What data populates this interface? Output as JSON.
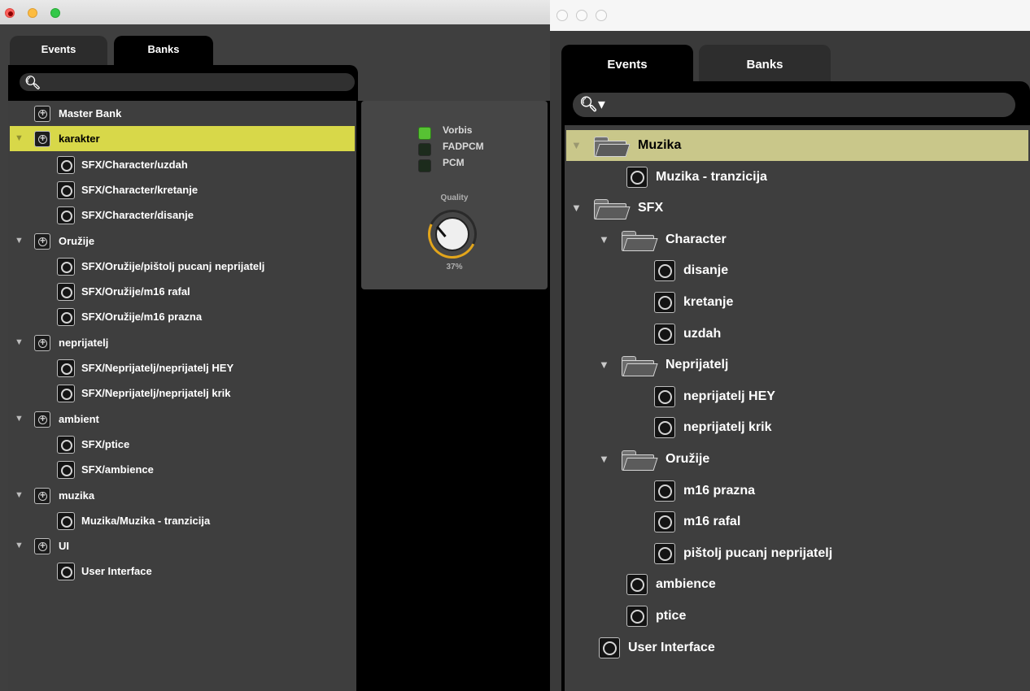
{
  "left_window": {
    "tabs": [
      {
        "label": "Events",
        "active": false
      },
      {
        "label": "Banks",
        "active": true
      }
    ],
    "search": {
      "placeholder": ""
    },
    "tree": [
      {
        "label": "Master Bank",
        "type": "bank",
        "expanded": null,
        "selected": false
      },
      {
        "label": "karakter",
        "type": "bank",
        "expanded": true,
        "selected": true
      },
      {
        "label": "SFX/Character/uzdah",
        "type": "event",
        "selected": false
      },
      {
        "label": "SFX/Character/kretanje",
        "type": "event",
        "selected": false
      },
      {
        "label": "SFX/Character/disanje",
        "type": "event",
        "selected": false
      },
      {
        "label": "Oružije",
        "type": "bank",
        "expanded": true,
        "selected": false
      },
      {
        "label": "SFX/Oružije/pištolj pucanj neprijatelj",
        "type": "event",
        "selected": false
      },
      {
        "label": "SFX/Oružije/m16 rafal",
        "type": "event",
        "selected": false
      },
      {
        "label": "SFX/Oružije/m16 prazna",
        "type": "event",
        "selected": false
      },
      {
        "label": "neprijatelj",
        "type": "bank",
        "expanded": true,
        "selected": false
      },
      {
        "label": "SFX/Neprijatelj/neprijatelj HEY",
        "type": "event",
        "selected": false
      },
      {
        "label": "SFX/Neprijatelj/neprijatelj krik",
        "type": "event",
        "selected": false
      },
      {
        "label": "ambient",
        "type": "bank",
        "expanded": true,
        "selected": false
      },
      {
        "label": "SFX/ptice",
        "type": "event",
        "selected": false
      },
      {
        "label": "SFX/ambience",
        "type": "event",
        "selected": false
      },
      {
        "label": "muzika",
        "type": "bank",
        "expanded": true,
        "selected": false
      },
      {
        "label": "Muzika/Muzika - tranzicija",
        "type": "event",
        "selected": false
      },
      {
        "label": "UI",
        "type": "bank",
        "expanded": true,
        "selected": false
      },
      {
        "label": "User Interface",
        "type": "event",
        "selected": false
      }
    ],
    "codec_panel": {
      "formats": [
        {
          "label": "Vorbis",
          "active": true
        },
        {
          "label": "FADPCM",
          "active": false
        },
        {
          "label": "PCM",
          "active": false
        }
      ],
      "quality_label": "Quality",
      "quality_value": "37%",
      "quality_fraction": 0.37,
      "accent_color": "#e2a51b"
    }
  },
  "right_window": {
    "tabs": [
      {
        "label": "Events",
        "active": true
      },
      {
        "label": "Banks",
        "active": false
      }
    ],
    "search": {
      "placeholder": ""
    },
    "tree": [
      {
        "label": "Muzika",
        "type": "folder",
        "expanded": true,
        "selected": true
      },
      {
        "label": "Muzika - tranzicija",
        "type": "event",
        "selected": false
      },
      {
        "label": "SFX",
        "type": "folder",
        "expanded": true,
        "selected": false
      },
      {
        "label": "Character",
        "type": "folder",
        "expanded": true,
        "selected": false
      },
      {
        "label": "disanje",
        "type": "event",
        "selected": false
      },
      {
        "label": "kretanje",
        "type": "event",
        "selected": false
      },
      {
        "label": "uzdah",
        "type": "event",
        "selected": false
      },
      {
        "label": "Neprijatelj",
        "type": "folder",
        "expanded": true,
        "selected": false
      },
      {
        "label": "neprijatelj HEY",
        "type": "event",
        "selected": false
      },
      {
        "label": "neprijatelj krik",
        "type": "event",
        "selected": false
      },
      {
        "label": "Oružije",
        "type": "folder",
        "expanded": true,
        "selected": false
      },
      {
        "label": "m16 prazna",
        "type": "event",
        "selected": false
      },
      {
        "label": "m16 rafal",
        "type": "event",
        "selected": false
      },
      {
        "label": "pištolj pucanj neprijatelj",
        "type": "event",
        "selected": false
      },
      {
        "label": "ambience",
        "type": "event",
        "selected": false
      },
      {
        "label": "ptice",
        "type": "event",
        "selected": false
      },
      {
        "label": "User Interface",
        "type": "event",
        "selected": false
      }
    ]
  },
  "colors": {
    "selection_left": "#d8d849",
    "selection_right": "#c9c78a",
    "led_on": "#57c233"
  }
}
